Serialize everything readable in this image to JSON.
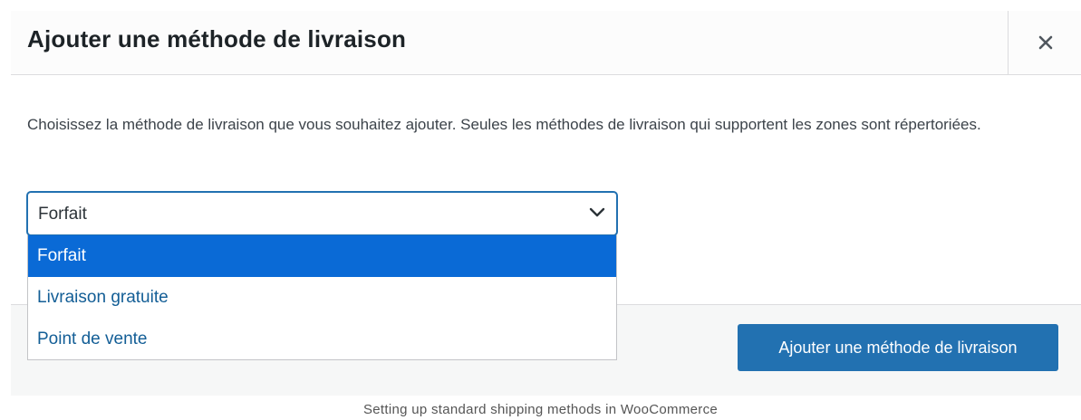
{
  "modal": {
    "title": "Ajouter une méthode de livraison",
    "close_icon": "close-icon",
    "description": "Choisissez la méthode de livraison que vous souhaitez ajouter. Seules les méthodes de livraison qui supportent les zones sont répertoriées.",
    "select": {
      "selected_value": "Forfait",
      "chevron_icon": "chevron-down-icon",
      "options": [
        "Forfait",
        "Livraison gratuite",
        "Point de vente"
      ],
      "highlighted_index": 0
    },
    "submit_label": "Ajouter une méthode de livraison"
  },
  "caption": "Setting up standard shipping methods in WooCommerce",
  "colors": {
    "accent": "#2271b1",
    "highlight": "#0a6ad6",
    "option_text": "#135e96",
    "title_text": "#1d2327",
    "body_text": "#3c434a"
  }
}
